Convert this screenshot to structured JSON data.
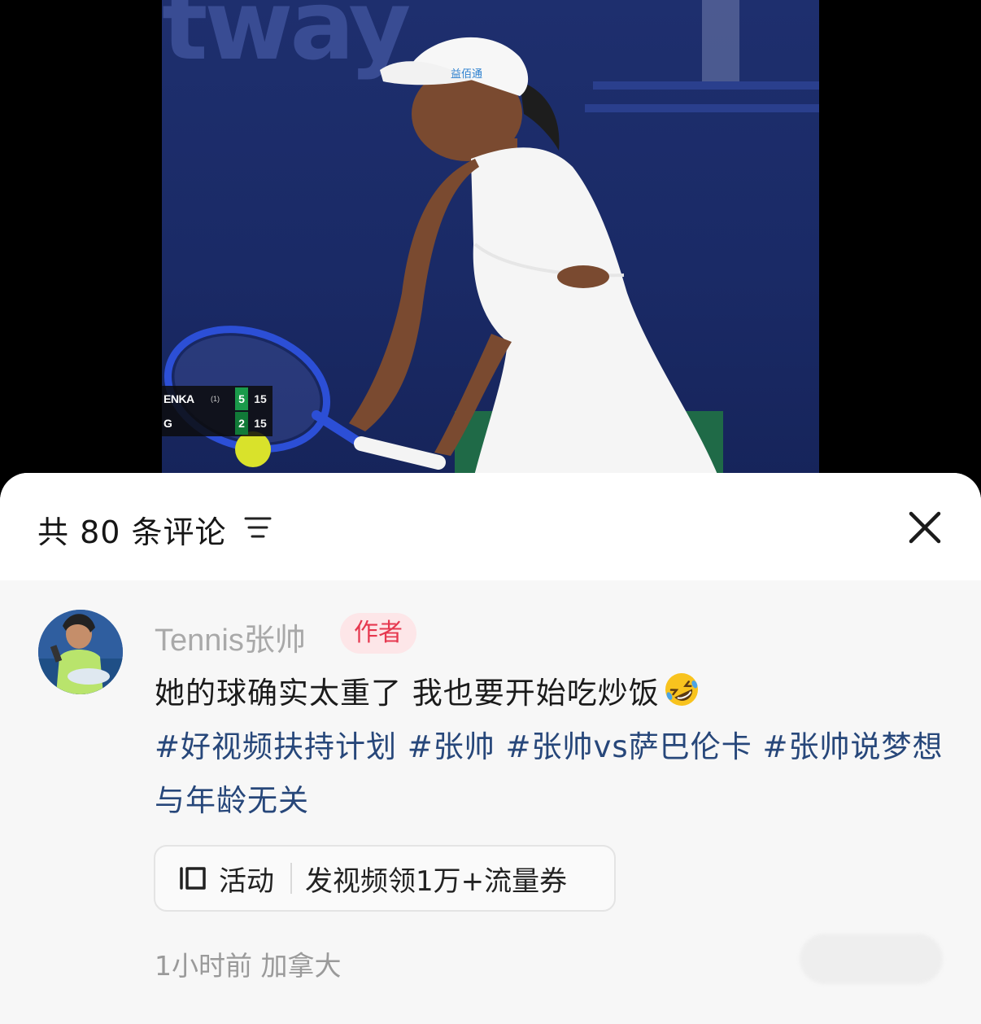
{
  "video": {
    "sponsor_text": "tway",
    "cap_logo": "益佰通",
    "scoreboard": {
      "rows": [
        {
          "name": "ENKA",
          "seed": "(1)",
          "games": "5",
          "points": "15"
        },
        {
          "name": "G",
          "seed": "",
          "games": "2",
          "points": "15"
        }
      ]
    }
  },
  "comments_sheet": {
    "title": "共 80 条评论",
    "sort_icon": "filter-lines-icon",
    "close_icon": "close-icon"
  },
  "comment": {
    "author": "Tennis张帅",
    "author_badge": "作者",
    "text": "她的球确实太重了 我也要开始吃炒饭",
    "emoji": "rofl-emoji",
    "hashtags_line": "#好视频扶持计划 #张帅 #张帅vs萨巴伦卡 #张帅说梦想与年龄无关",
    "activity": {
      "icon": "activity-icon",
      "label": "活动",
      "text": "发视频领1万+流量券"
    },
    "time": "1小时前",
    "location": "加拿大"
  },
  "colors": {
    "accent_tag": "#27477a",
    "badge_text": "#e6384f",
    "badge_bg": "#fde6e8",
    "muted": "#9a9a9a"
  }
}
